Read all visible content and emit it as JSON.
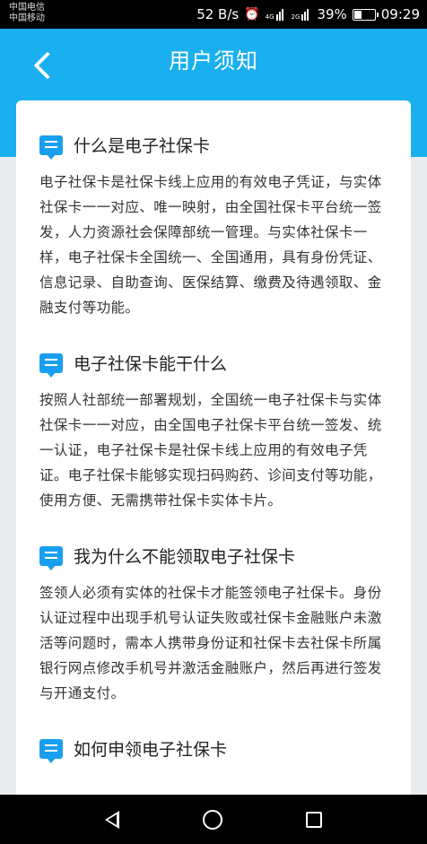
{
  "status_bar": {
    "carrier_1": "中国电信",
    "carrier_2": "中国移动",
    "network_speed": "52 B/s",
    "signal_1_type": "4G",
    "signal_2_type": "2G",
    "battery_percent": "39%",
    "battery_level": 0.39,
    "time": "09:29"
  },
  "header": {
    "title": "用户须知"
  },
  "sections": [
    {
      "title": "什么是电子社保卡",
      "body": "电子社保卡是社保卡线上应用的有效电子凭证，与实体社保卡一一对应、唯一映射，由全国社保卡平台统一签发，人力资源社会保障部统一管理。与实体社保卡一样，电子社保卡全国统一、全国通用，具有身份凭证、信息记录、自助查询、医保结算、缴费及待遇领取、金融支付等功能。"
    },
    {
      "title": "电子社保卡能干什么",
      "body": "按照人社部统一部署规划，全国统一电子社保卡与实体社保卡一一对应，由全国电子社保卡平台统一签发、统一认证，电子社保卡是社保卡线上应用的有效电子凭证。电子社保卡能够实现扫码购药、诊间支付等功能，使用方便、无需携带社保卡实体卡片。"
    },
    {
      "title": "我为什么不能领取电子社保卡",
      "body": "签领人必须有实体的社保卡才能签领电子社保卡。身份认证过程中出现手机号认证失败或社保卡金融账户未激活等问题时，需本人携带身份证和社保卡去社保卡所属银行网点修改手机号并激活金融账户，然后再进行签发与开通支付。"
    },
    {
      "title": "如何申领电子社保卡",
      "body": ""
    }
  ]
}
